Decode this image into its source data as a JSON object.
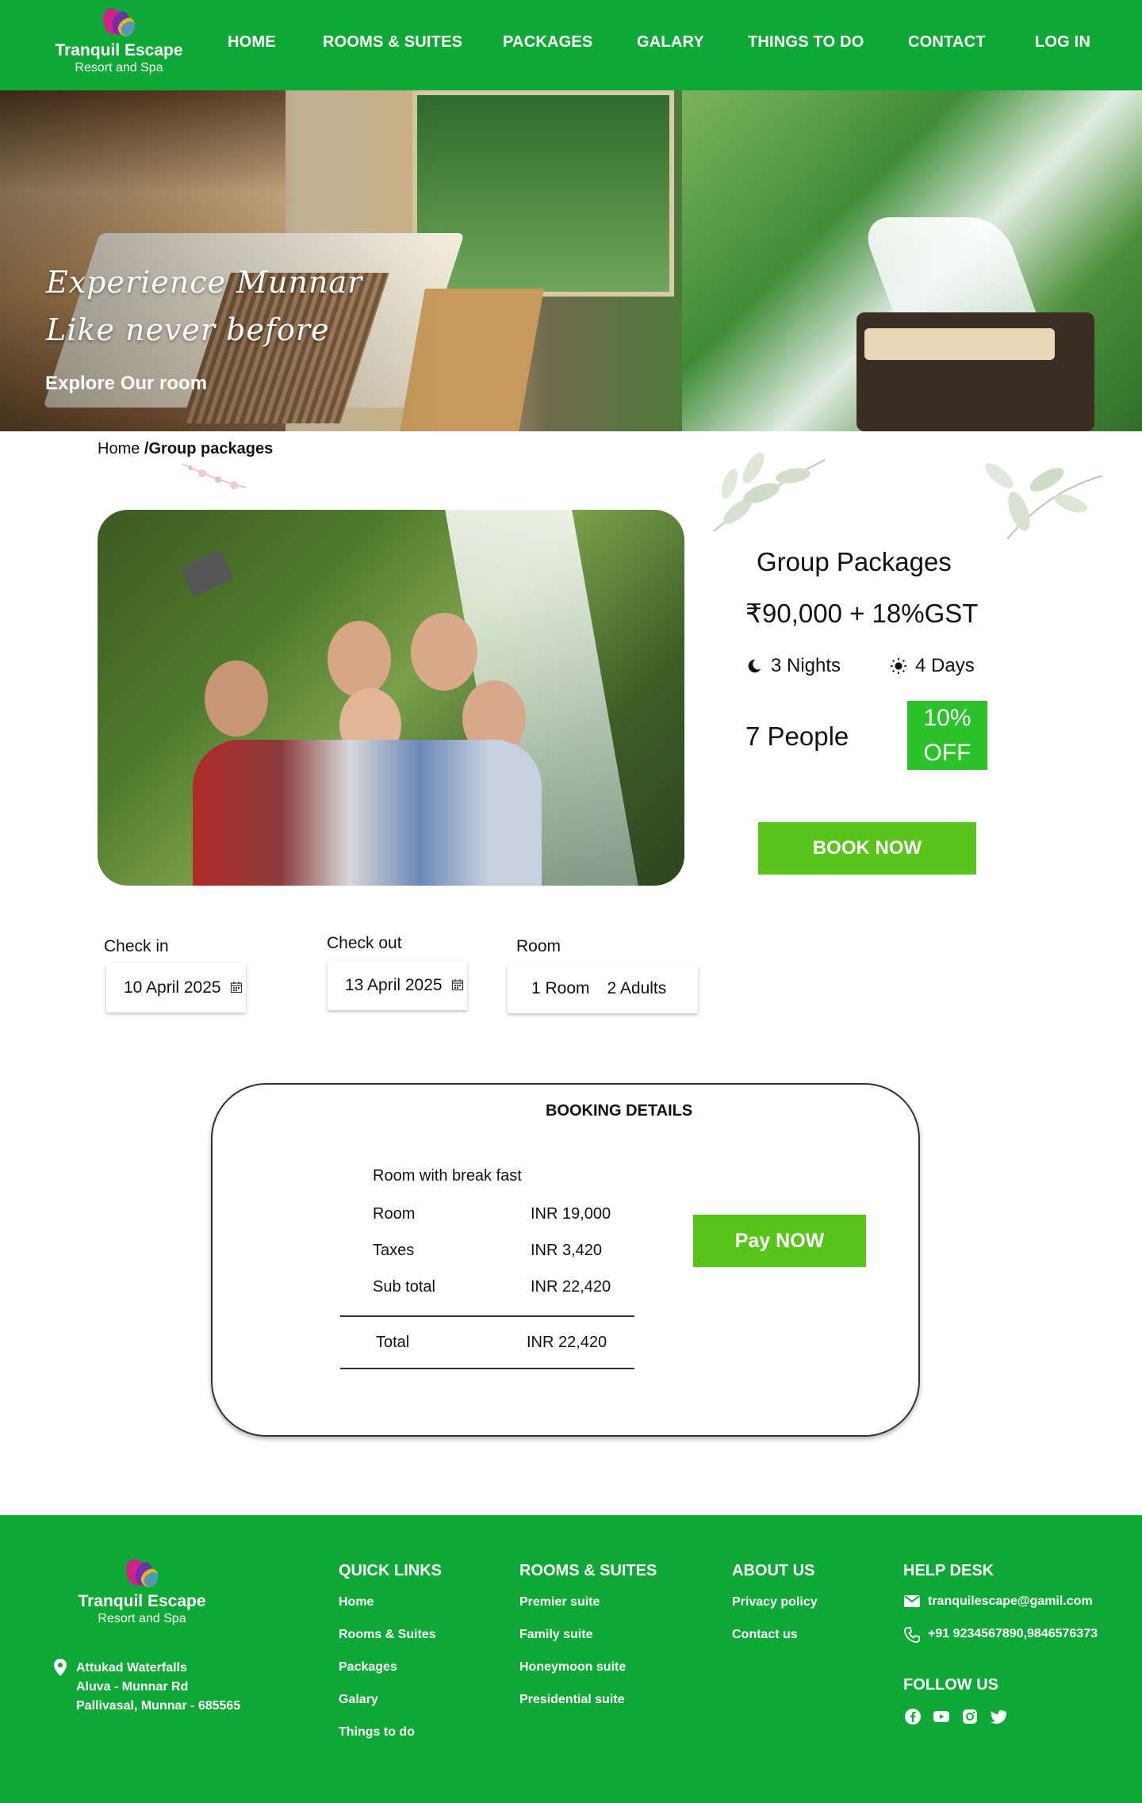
{
  "brand": {
    "name": "Tranquil Escape",
    "tagline": "Resort and Spa",
    "colors": {
      "primary": "#0ea836",
      "button": "#58c51a",
      "discount": "#2bc22b"
    }
  },
  "nav": {
    "items": [
      {
        "label": "HOME"
      },
      {
        "label": "ROOMS & SUITES"
      },
      {
        "label": "PACKAGES"
      },
      {
        "label": "GALARY"
      },
      {
        "label": "THINGS TO DO"
      },
      {
        "label": "CONTACT"
      },
      {
        "label": "LOG IN"
      }
    ]
  },
  "hero": {
    "line1": "Experience Munnar",
    "line2": "Like never before",
    "cta": "Explore Our room"
  },
  "breadcrumb": {
    "home": "Home",
    "current": "/Group packages"
  },
  "package": {
    "title": "Group Packages",
    "price": "₹90,000 + 18%GST",
    "nights": "3 Nights",
    "days": "4 Days",
    "people": "7 People",
    "discount_line1": "10%",
    "discount_line2": "OFF",
    "book_label": "BOOK NOW"
  },
  "form": {
    "checkin_label": "Check in",
    "checkin_value": "10 April 2025",
    "checkout_label": "Check out",
    "checkout_value": "13 April 2025",
    "room_label": "Room",
    "room_value": "1 Room",
    "guests_value": "2 Adults"
  },
  "booking": {
    "title": "BOOKING DETAILS",
    "subtitle": "Room with break fast",
    "rows": [
      {
        "label": "Room",
        "value": "INR 19,000"
      },
      {
        "label": "Taxes",
        "value": "INR 3,420"
      },
      {
        "label": "Sub total",
        "value": "INR 22,420"
      }
    ],
    "total_label": "Total",
    "total_value": "INR 22,420",
    "pay_label": "Pay NOW"
  },
  "footer": {
    "address": [
      "Attukad Waterfalls",
      "Aluva - Munnar Rd",
      "Pallivasal, Munnar - 685565"
    ],
    "quick_links": {
      "heading": "QUICK LINKS",
      "items": [
        "Home",
        "Rooms & Suites",
        "Packages",
        "Galary",
        "Things to do"
      ]
    },
    "rooms": {
      "heading": "ROOMS & SUITES",
      "items": [
        "Premier suite",
        "Family suite",
        "Honeymoon suite",
        "Presidential suite"
      ]
    },
    "about": {
      "heading": "ABOUT US",
      "items": [
        "Privacy policy",
        "Contact us"
      ]
    },
    "help": {
      "heading": "HELP DESK",
      "email": "tranquilescape@gamil.com",
      "phone": "+91 9234567890,9846576373"
    },
    "follow": {
      "heading": "FOLLOW US",
      "icons": [
        "facebook-icon",
        "youtube-icon",
        "instagram-icon",
        "twitter-icon"
      ]
    }
  }
}
